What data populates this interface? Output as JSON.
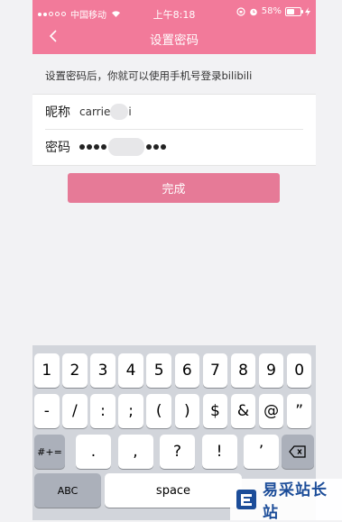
{
  "status": {
    "carrier": "中国移动",
    "time": "上午8:18",
    "battery": "58%",
    "battery_level": 0.58
  },
  "nav": {
    "title": "设置密码"
  },
  "hint": "设置密码后，你就可以使用手机号登录bilibili",
  "form": {
    "nickname_label": "昵称",
    "nickname_value_visible_start": "carrie",
    "nickname_value_visible_end": "i",
    "password_label": "密码"
  },
  "done_label": "完成",
  "keyboard": {
    "row1": [
      "1",
      "2",
      "3",
      "4",
      "5",
      "6",
      "7",
      "8",
      "9",
      "0"
    ],
    "row2": [
      "-",
      "/",
      ":",
      ";",
      "(",
      ")",
      "$",
      "&",
      "@",
      "”"
    ],
    "row3_mode": "#+=",
    "row3": [
      ".",
      ",",
      "?",
      "!",
      "’"
    ],
    "abc": "ABC",
    "space": "space"
  },
  "watermark": "易采站长站"
}
